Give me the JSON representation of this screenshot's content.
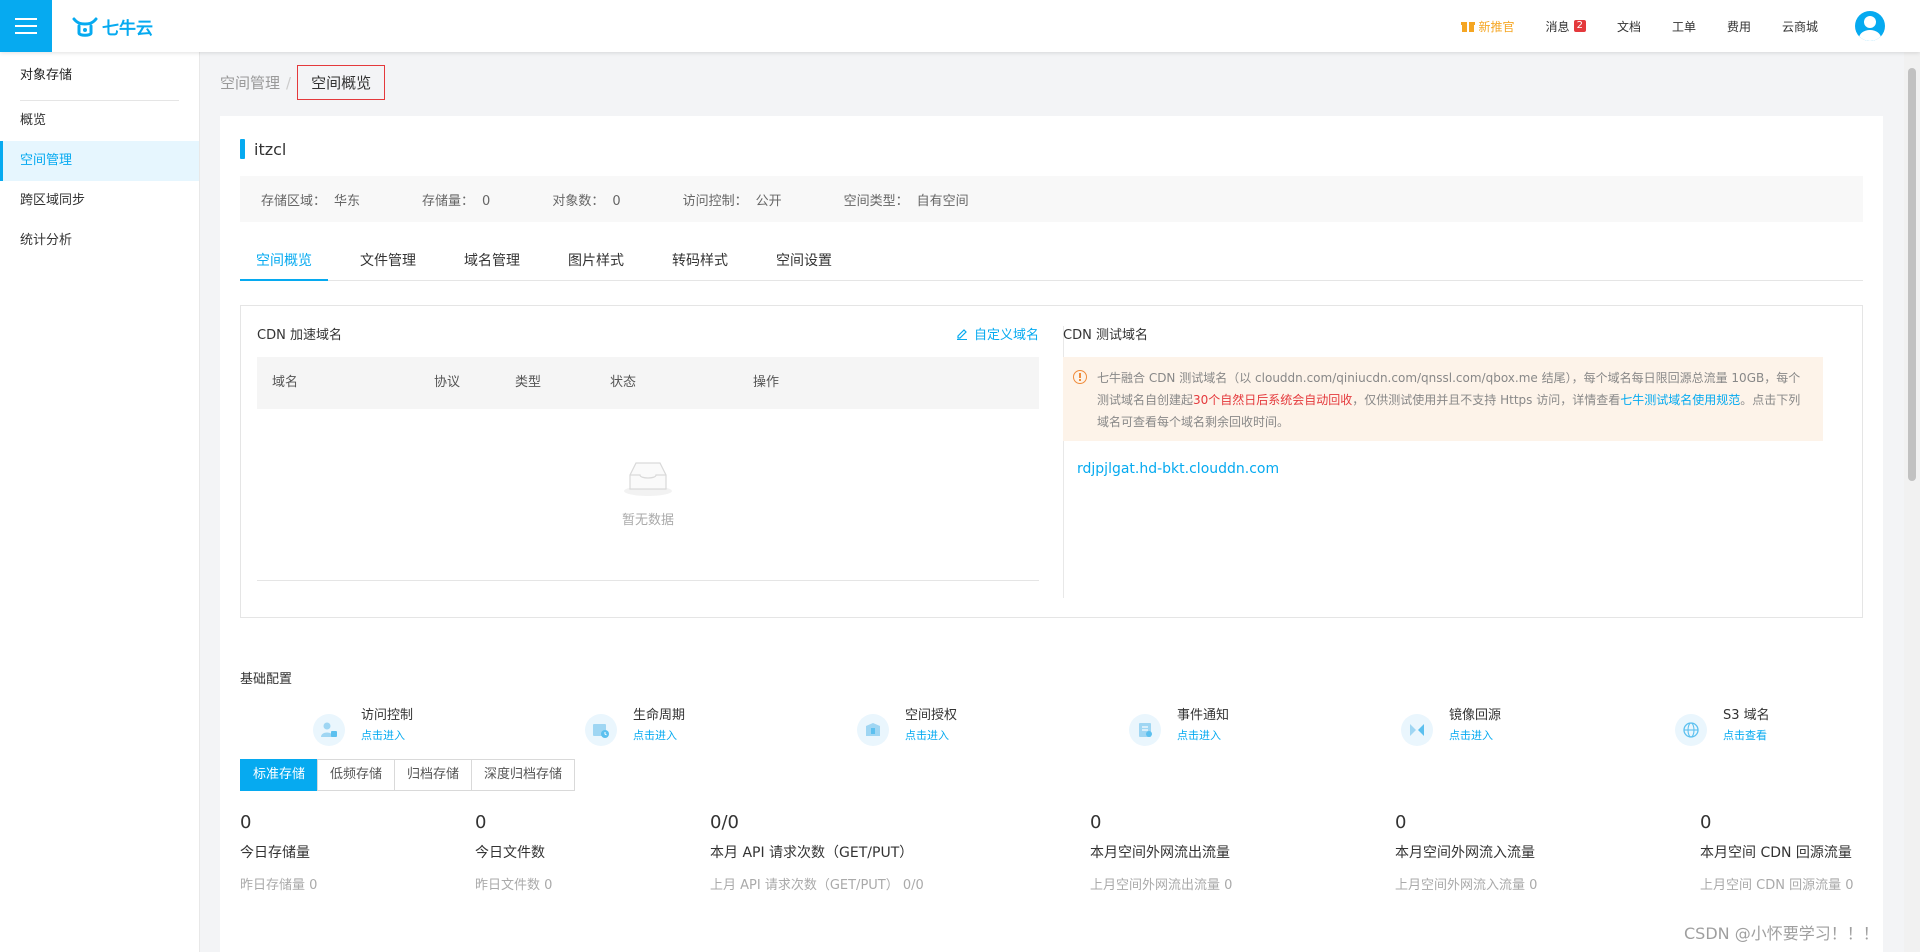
{
  "header": {
    "logo_text": "七牛云",
    "nav": [
      {
        "label": "新推官",
        "icon": "gift-icon"
      },
      {
        "label": "消息",
        "badge": "2"
      },
      {
        "label": "文档"
      },
      {
        "label": "工单"
      },
      {
        "label": "费用"
      },
      {
        "label": "云商城"
      }
    ]
  },
  "sidebar": {
    "title": "对象存储",
    "items": [
      {
        "label": "概览"
      },
      {
        "label": "空间管理",
        "active": true
      },
      {
        "label": "跨区域同步"
      },
      {
        "label": "统计分析"
      }
    ]
  },
  "breadcrumb": {
    "parent": "空间管理",
    "sep": "/",
    "current": "空间概览"
  },
  "bucket": {
    "name": "itzcl",
    "info": [
      {
        "key": "存储区域：",
        "value": "华东"
      },
      {
        "key": "存储量：",
        "value": "0"
      },
      {
        "key": "对象数：",
        "value": "0"
      },
      {
        "key": "访问控制：",
        "value": "公开"
      },
      {
        "key": "空间类型：",
        "value": "自有空间"
      }
    ]
  },
  "tabs": [
    "空间概览",
    "文件管理",
    "域名管理",
    "图片样式",
    "转码样式",
    "空间设置"
  ],
  "cdn": {
    "title": "CDN 加速域名",
    "custom_domain": "自定义域名",
    "columns": [
      "域名",
      "协议",
      "类型",
      "状态",
      "操作"
    ],
    "empty_text": "暂无数据"
  },
  "cdn_test": {
    "title": "CDN 测试域名",
    "notice_part1": "七牛融合 CDN 测试域名（以 clouddn.com/qiniucdn.com/qnssl.com/qbox.me 结尾），每个域名每日限回源总流量 10GB，每个测试域名自创建起",
    "notice_red": "30个自然日后系统会自动回收",
    "notice_part2": "，仅供测试使用并且不支持 Https 访问，详情查看",
    "notice_link": "七牛测试域名使用规范",
    "notice_part3": "。点击下列域名可查看每个域名剩余回收时间。",
    "domain": "rdjpjlgat.hd-bkt.clouddn.com"
  },
  "config": {
    "title": "基础配置",
    "items": [
      {
        "name": "访问控制",
        "link": "点击进入",
        "icon": "access-control-icon"
      },
      {
        "name": "生命周期",
        "link": "点击进入",
        "icon": "lifecycle-icon"
      },
      {
        "name": "空间授权",
        "link": "点击进入",
        "icon": "authorization-icon"
      },
      {
        "name": "事件通知",
        "link": "点击进入",
        "icon": "event-notify-icon"
      },
      {
        "name": "镜像回源",
        "link": "点击进入",
        "icon": "mirror-icon"
      },
      {
        "name": "S3 域名",
        "link": "点击查看",
        "icon": "globe-icon"
      }
    ]
  },
  "storage_tabs": [
    "标准存储",
    "低频存储",
    "归档存储",
    "深度归档存储"
  ],
  "stats": [
    {
      "value": "0",
      "label": "今日存储量",
      "sub": "昨日存储量 0"
    },
    {
      "value": "0",
      "label": "今日文件数",
      "sub": "昨日文件数 0"
    },
    {
      "value": "0/0",
      "label": "本月 API 请求次数（GET/PUT）",
      "sub": "上月 API 请求次数（GET/PUT）  0/0"
    },
    {
      "value": "0",
      "label": "本月空间外网流出流量",
      "sub": "上月空间外网流出流量 0"
    },
    {
      "value": "0",
      "label": "本月空间外网流入流量",
      "sub": "上月空间外网流入流量 0"
    },
    {
      "value": "0",
      "label": "本月空间 CDN 回源流量",
      "sub": "上月空间 CDN 回源流量 0"
    }
  ],
  "watermark": "CSDN @小怀要学习！！！",
  "colors": {
    "accent": "#06aaf0",
    "warning_bg": "#fdf3e9",
    "red": "#e4393c"
  }
}
